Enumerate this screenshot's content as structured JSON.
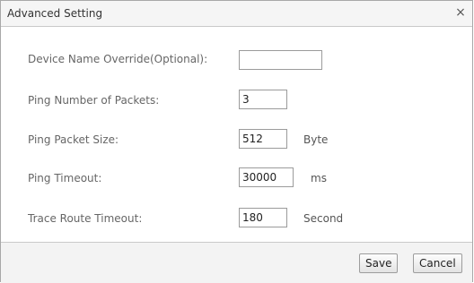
{
  "dialog": {
    "title": "Advanced Setting",
    "close_glyph": "×"
  },
  "fields": [
    {
      "label": "Device Name Override(Optional):",
      "value": "",
      "unit": ""
    },
    {
      "label": "Ping Number of Packets:",
      "value": "3",
      "unit": ""
    },
    {
      "label": "Ping Packet Size:",
      "value": "512",
      "unit": "Byte"
    },
    {
      "label": "Ping Timeout:",
      "value": "30000",
      "unit": "ms"
    },
    {
      "label": "Trace Route Timeout:",
      "value": "180",
      "unit": "Second"
    }
  ],
  "footer": {
    "save_label": "Save",
    "cancel_label": "Cancel"
  }
}
